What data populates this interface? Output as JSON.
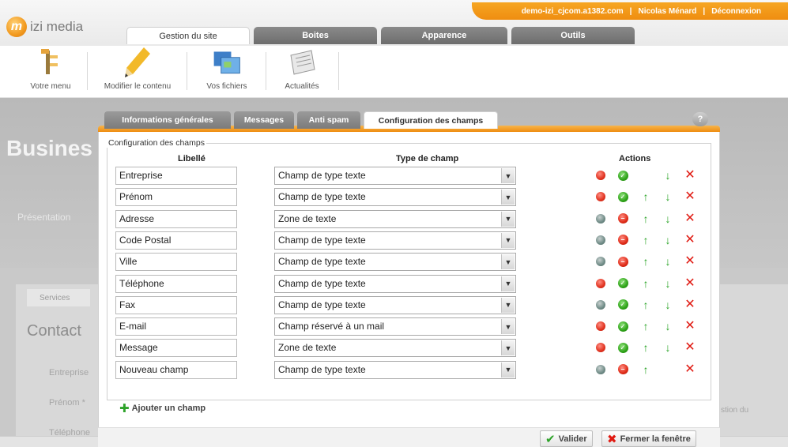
{
  "app": {
    "logo_text": "izi media",
    "logo_badge": "m",
    "user_host": "demo-izi_cjcom.a1382.com",
    "user_name": "Nicolas Ménard",
    "logout": "Déconnexion",
    "separator": "|"
  },
  "main_tabs": [
    "Gestion du site",
    "Boites",
    "Apparence",
    "Outils"
  ],
  "toolbar": {
    "items": [
      {
        "label": "Votre menu",
        "icon": "menu-tree-icon"
      },
      {
        "label": "Modifier le contenu",
        "icon": "pencil-icon"
      },
      {
        "label": "Vos fichiers",
        "icon": "files-icon"
      },
      {
        "label": "Actualités",
        "icon": "newspaper-icon"
      }
    ]
  },
  "background": {
    "title": "Busines",
    "nav_item": "Présentation",
    "chip": "Services",
    "contact": "Contact",
    "field1": "Entreprise",
    "field2": "Prénom *",
    "field3": "Téléphone",
    "right_text": "stion du"
  },
  "modal": {
    "tabs": [
      "Informations générales",
      "Messages",
      "Anti spam",
      "Configuration des champs"
    ],
    "help": "?",
    "legend": "Configuration des champs",
    "col_label": "Libellé",
    "col_type": "Type de champ",
    "col_actions": "Actions",
    "rows": [
      {
        "label": "Entreprise",
        "type": "Champ de type texte",
        "status": "red",
        "toggle": "check",
        "up": false,
        "down": true
      },
      {
        "label": "Prénom",
        "type": "Champ de type texte",
        "status": "red",
        "toggle": "check",
        "up": true,
        "down": true
      },
      {
        "label": "Adresse",
        "type": "Zone de texte",
        "status": "gray",
        "toggle": "minus",
        "up": true,
        "down": true
      },
      {
        "label": "Code Postal",
        "type": "Champ de type texte",
        "status": "gray",
        "toggle": "minus",
        "up": true,
        "down": true
      },
      {
        "label": "Ville",
        "type": "Champ de type texte",
        "status": "gray",
        "toggle": "minus",
        "up": true,
        "down": true
      },
      {
        "label": "Téléphone",
        "type": "Champ de type texte",
        "status": "red",
        "toggle": "check",
        "up": true,
        "down": true
      },
      {
        "label": "Fax",
        "type": "Champ de type texte",
        "status": "gray",
        "toggle": "check",
        "up": true,
        "down": true
      },
      {
        "label": "E-mail",
        "type": "Champ réservé à un mail",
        "status": "red",
        "toggle": "check",
        "up": true,
        "down": true
      },
      {
        "label": "Message",
        "type": "Zone de texte",
        "status": "red",
        "toggle": "check",
        "up": true,
        "down": true
      },
      {
        "label": "Nouveau champ",
        "type": "Champ de type texte",
        "status": "gray",
        "toggle": "minus",
        "up": true,
        "down": false
      }
    ],
    "add_field": "Ajouter un champ",
    "validate": "Valider",
    "close": "Fermer la fenêtre"
  },
  "colors": {
    "accent_orange": "#ef8d10",
    "green": "#2da52a",
    "red": "#e01a12"
  }
}
